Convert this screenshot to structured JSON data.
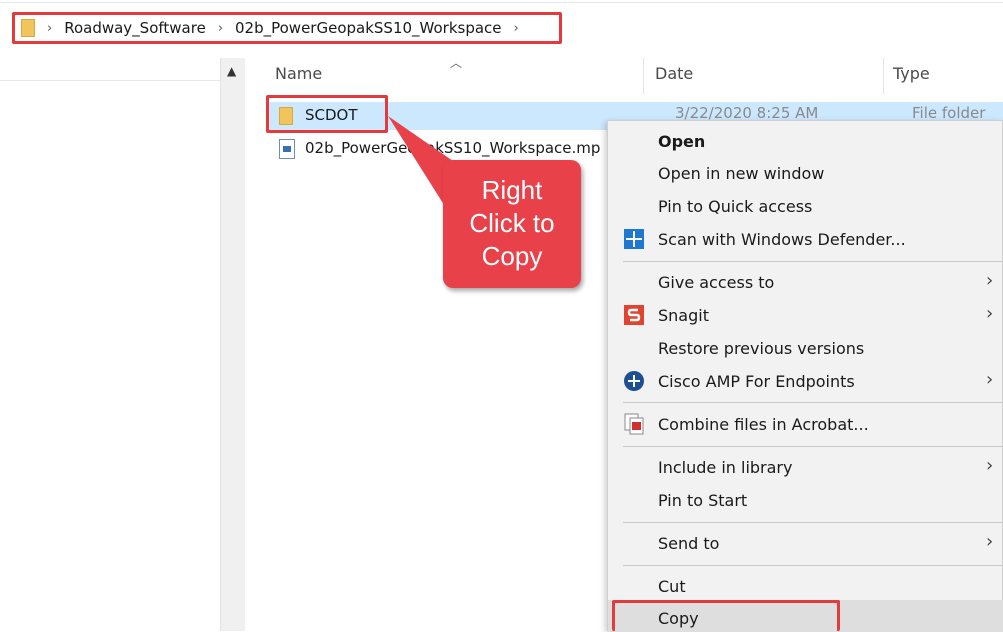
{
  "breadcrumb": {
    "items": [
      "Roadway_Software",
      "02b_PowerGeopakSS10_Workspace"
    ]
  },
  "columns": {
    "name": "Name",
    "date": "Date",
    "type": "Type"
  },
  "files": [
    {
      "name": "SCDOT",
      "date": "3/22/2020 8:25 AM",
      "type": "File folder",
      "icon": "folder-icon"
    },
    {
      "name": "02b_PowerGeopakSS10_Workspace.mp",
      "icon": "file-icon"
    }
  ],
  "callout": {
    "line1": "Right",
    "line2": "Click to",
    "line3": "Copy"
  },
  "context_menu": {
    "items": [
      {
        "label": "Open",
        "bold": true
      },
      {
        "label": "Open in new window"
      },
      {
        "label": "Pin to Quick access"
      },
      {
        "label": "Scan with Windows Defender...",
        "icon": "windows-defender-icon"
      },
      {
        "label": "Give access to",
        "submenu": true
      },
      {
        "label": "Snagit",
        "icon": "snagit-icon",
        "submenu": true
      },
      {
        "label": "Restore previous versions"
      },
      {
        "label": "Cisco AMP For Endpoints",
        "icon": "cisco-amp-icon",
        "submenu": true
      },
      {
        "label": "Combine files in Acrobat...",
        "icon": "acrobat-icon"
      },
      {
        "label": "Include in library",
        "submenu": true
      },
      {
        "label": "Pin to Start"
      },
      {
        "label": "Send to",
        "submenu": true
      },
      {
        "label": "Cut"
      },
      {
        "label": "Copy",
        "highlighted": true
      }
    ]
  },
  "colors": {
    "highlight_border": "#e23b3b",
    "callout_fill": "#e8414a",
    "selection": "#cce8ff",
    "menu_bg": "#f2f2f2"
  }
}
